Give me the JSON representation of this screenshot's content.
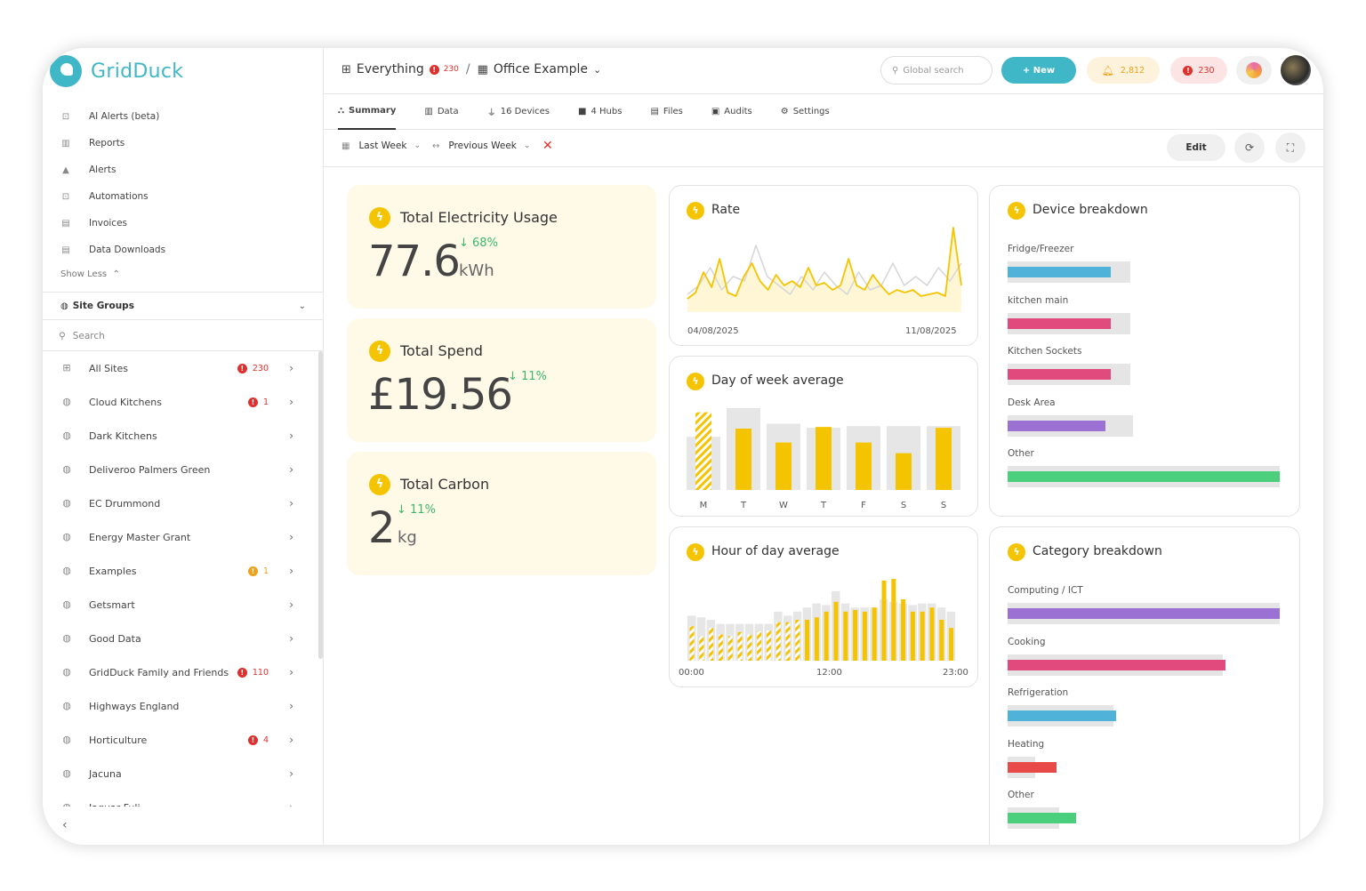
{
  "app": {
    "name": "GridDuck"
  },
  "menu": [
    {
      "label": "AI Alerts (beta)",
      "icon": "robot-icon"
    },
    {
      "label": "Reports",
      "icon": "chart-icon"
    },
    {
      "label": "Alerts",
      "icon": "bell-icon"
    },
    {
      "label": "Automations",
      "icon": "robot-icon"
    },
    {
      "label": "Invoices",
      "icon": "file-icon"
    },
    {
      "label": "Data Downloads",
      "icon": "file-download-icon"
    }
  ],
  "show_less": "Show Less",
  "site_groups": {
    "label": "Site Groups",
    "search_placeholder": "Search"
  },
  "sites": [
    {
      "name": "All Sites",
      "badge": "230",
      "badge_color": "red"
    },
    {
      "name": "Cloud Kitchens",
      "badge": "1",
      "badge_color": "red"
    },
    {
      "name": "Dark Kitchens",
      "badge": "",
      "badge_color": ""
    },
    {
      "name": "Deliveroo Palmers Green",
      "badge": "",
      "badge_color": ""
    },
    {
      "name": "EC Drummond",
      "badge": "",
      "badge_color": ""
    },
    {
      "name": "Energy Master Grant",
      "badge": "",
      "badge_color": ""
    },
    {
      "name": "Examples",
      "badge": "1",
      "badge_color": "orange"
    },
    {
      "name": "Getsmart",
      "badge": "",
      "badge_color": ""
    },
    {
      "name": "Good Data",
      "badge": "",
      "badge_color": ""
    },
    {
      "name": "GridDuck Family and Friends",
      "badge": "110",
      "badge_color": "red"
    },
    {
      "name": "Highways England",
      "badge": "",
      "badge_color": ""
    },
    {
      "name": "Horticulture",
      "badge": "4",
      "badge_color": "red"
    },
    {
      "name": "Jacuna",
      "badge": "",
      "badge_color": ""
    },
    {
      "name": "Jaguar Fuli...",
      "badge": "",
      "badge_color": "red"
    }
  ],
  "topbar": {
    "crumb_root": "Everything",
    "crumb_root_alerts": "230",
    "crumb_sep": "/",
    "crumb_current": "Office Example",
    "search_placeholder": "Global search",
    "new_button": "+ New",
    "notifications_count": "2,812",
    "alerts_count": "230"
  },
  "tabs": [
    {
      "label": "Summary",
      "icon": "sitemap-icon",
      "active": true
    },
    {
      "label": "Data",
      "icon": "chart-icon",
      "active": false
    },
    {
      "label": "16 Devices",
      "icon": "plug-icon",
      "active": false
    },
    {
      "label": "4 Hubs",
      "icon": "hub-icon",
      "active": false
    },
    {
      "label": "Files",
      "icon": "file-icon",
      "active": false
    },
    {
      "label": "Audits",
      "icon": "clipboard-icon",
      "active": false
    },
    {
      "label": "Settings",
      "icon": "gear-icon",
      "active": false
    }
  ],
  "filters": {
    "period": "Last Week",
    "compare": "Previous Week",
    "edit": "Edit"
  },
  "kpis": [
    {
      "title": "Total Electricity Usage",
      "value": "77.6",
      "unit": "kWh",
      "delta": "68%"
    },
    {
      "title": "Total Spend",
      "value": "£19.56",
      "unit": "",
      "delta": "11%"
    },
    {
      "title": "Total Carbon",
      "value": "2",
      "unit": "kg",
      "delta": "11%"
    }
  ],
  "colors": {
    "accent": "#3fb7c7",
    "yellow": "#f5c400",
    "kpi_bg": "#fff9e8",
    "green": "#3bb86a",
    "red": "#e0302d"
  },
  "chart_data": [
    {
      "type": "line",
      "title": "Rate",
      "x_start": "04/08/2025",
      "x_end": "11/08/2025",
      "series": [
        {
          "values": [
            0.15,
            0.22,
            0.45,
            0.28,
            0.6,
            0.22,
            0.18,
            0.4,
            0.55,
            0.35,
            0.25,
            0.42,
            0.3,
            0.35,
            0.28,
            0.5,
            0.3,
            0.33,
            0.25,
            0.3,
            0.6,
            0.3,
            0.25,
            0.42,
            0.3,
            0.2,
            0.25,
            0.22,
            0.25,
            0.18,
            0.2,
            0.22,
            0.18,
            0.95,
            0.3
          ]
        },
        {
          "values": [
            0.2,
            0.3,
            0.5,
            0.25,
            0.4,
            0.35,
            0.75,
            0.4,
            0.3,
            0.2,
            0.4,
            0.25,
            0.45,
            0.3,
            0.2,
            0.45,
            0.25,
            0.3,
            0.55,
            0.3,
            0.4,
            0.3,
            0.5,
            0.35,
            0.55
          ]
        }
      ]
    },
    {
      "type": "bar",
      "title": "Day of week average",
      "categories": [
        "M",
        "T",
        "W",
        "T",
        "F",
        "S",
        "S"
      ],
      "series": [
        {
          "values": [
            0.95,
            0.75,
            0.58,
            0.77,
            0.58,
            0.45,
            0.76
          ]
        },
        {
          "values": [
            0.65,
            1.0,
            0.81,
            0.76,
            0.78,
            0.78,
            0.78
          ]
        }
      ]
    },
    {
      "type": "bar",
      "title": "Hour of day average",
      "x_labels": [
        "00:00",
        "12:00",
        "23:00"
      ],
      "series": [
        {
          "values": [
            0.42,
            0.3,
            0.4,
            0.32,
            0.3,
            0.35,
            0.32,
            0.36,
            0.37,
            0.47,
            0.47,
            0.5,
            0.5,
            0.53,
            0.6,
            0.72,
            0.6,
            0.62,
            0.6,
            0.65,
            0.98,
            1.0,
            0.75,
            0.6,
            0.6,
            0.65,
            0.5,
            0.4
          ]
        },
        {
          "values": [
            0.55,
            0.53,
            0.5,
            0.45,
            0.45,
            0.45,
            0.45,
            0.45,
            0.45,
            0.6,
            0.55,
            0.6,
            0.65,
            0.7,
            0.68,
            0.85,
            0.7,
            0.65,
            0.65,
            0.65,
            0.75,
            0.72,
            0.7,
            0.68,
            0.7,
            0.7,
            0.65,
            0.6
          ]
        }
      ]
    },
    {
      "type": "bar",
      "title": "Device breakdown",
      "categories": [
        "Fridge/Freezer",
        "kitchen main",
        "Kitchen Sockets",
        "Desk Area",
        "Other"
      ],
      "series": [
        {
          "values": [
            0.38,
            0.38,
            0.38,
            0.36,
            1.0
          ],
          "colors": [
            "#4fb3d9",
            "#e04a7c",
            "#e04a7c",
            "#9b72d4",
            "#4ccf7c"
          ]
        },
        {
          "values": [
            0.45,
            0.45,
            0.45,
            0.46,
            1.0
          ]
        }
      ]
    },
    {
      "type": "bar",
      "title": "Category breakdown",
      "categories": [
        "Computing / ICT",
        "Cooking",
        "Refrigeration",
        "Heating",
        "Other"
      ],
      "series": [
        {
          "values": [
            1.0,
            0.8,
            0.4,
            0.18,
            0.25
          ],
          "colors": [
            "#9b72d4",
            "#e04a7c",
            "#4fb3d9",
            "#e84a4a",
            "#4ccf7c"
          ]
        },
        {
          "values": [
            1.0,
            0.79,
            0.39,
            0.1,
            0.19
          ]
        }
      ]
    }
  ]
}
